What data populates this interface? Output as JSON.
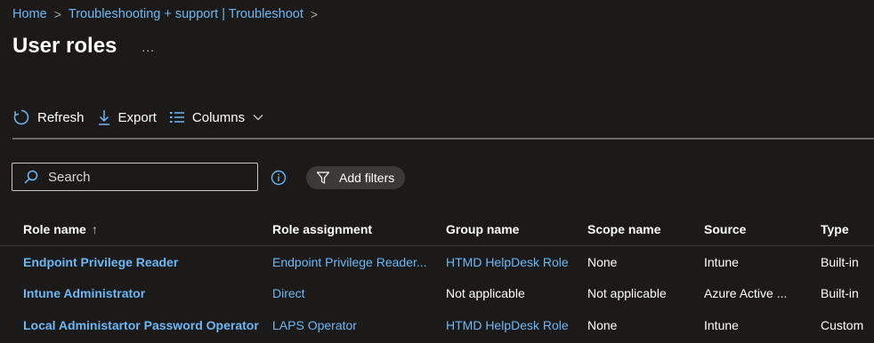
{
  "breadcrumb": {
    "items": [
      "Home",
      "Troubleshooting + support | Troubleshoot"
    ],
    "separator": ">"
  },
  "page": {
    "title": "User roles",
    "more_label": "..."
  },
  "toolbar": {
    "refresh_label": "Refresh",
    "export_label": "Export",
    "columns_label": "Columns"
  },
  "search": {
    "value": "",
    "placeholder": "Search"
  },
  "filters": {
    "add_label": "Add filters"
  },
  "table": {
    "columns": [
      "Role name",
      "Role assignment",
      "Group name",
      "Scope name",
      "Source",
      "Type"
    ],
    "sort_indicator": "↑",
    "rows": [
      {
        "role_name": "Endpoint Privilege Reader",
        "role_assignment": "Endpoint Privilege Reader...",
        "group_name": "HTMD HelpDesk Role",
        "scope_name": "None",
        "source": "Intune",
        "type": "Built-in"
      },
      {
        "role_name": "Intune Administrator",
        "role_assignment": "Direct",
        "group_name": "Not applicable",
        "scope_name": "Not applicable",
        "source": "Azure Active ...",
        "type": "Built-in"
      },
      {
        "role_name": "Local Administartor Password Operator",
        "role_assignment": "LAPS Operator",
        "group_name": "HTMD HelpDesk Role",
        "scope_name": "None",
        "source": "Intune",
        "type": "Custom"
      }
    ]
  },
  "colors": {
    "background": "#1b1a19",
    "link": "#6cb8f6",
    "text": "#ffffff",
    "pill": "#3b3a39"
  },
  "icons": {
    "refresh": "refresh-icon",
    "export": "download-icon",
    "columns": "columns-icon",
    "chevron": "chevron-down-icon",
    "search": "search-icon",
    "info": "info-icon",
    "filter": "filter-icon"
  }
}
